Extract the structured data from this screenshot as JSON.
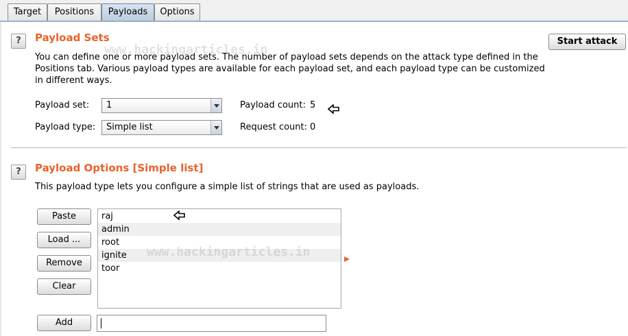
{
  "tabs": [
    "Target",
    "Positions",
    "Payloads",
    "Options"
  ],
  "active_tab": "Payloads",
  "payload_sets": {
    "help_glyph": "?",
    "title": "Payload Sets",
    "description": "You can define one or more payload sets. The number of payload sets depends on the attack type defined in the Positions tab. Various payload types are available for each payload set, and each payload type can be customized in different ways.",
    "start_attack_label": "Start attack",
    "payload_set_label": "Payload set:",
    "payload_set_value": "1",
    "payload_type_label": "Payload type:",
    "payload_type_value": "Simple list",
    "payload_count_label": "Payload count:",
    "payload_count_value": "5",
    "request_count_label": "Request count:",
    "request_count_value": "0"
  },
  "payload_options": {
    "help_glyph": "?",
    "title": "Payload Options [Simple list]",
    "description": "This payload type lets you configure a simple list of strings that are used as payloads.",
    "buttons": {
      "paste": "Paste",
      "load": "Load ...",
      "remove": "Remove",
      "clear": "Clear",
      "add": "Add"
    },
    "items": [
      "raj",
      "admin",
      "root",
      "ignite",
      "toor"
    ],
    "add_input_value": ""
  },
  "watermark": "www.hackingarticles.in",
  "colors": {
    "section_title": "#e8622b",
    "active_tab": "#bccddf"
  }
}
